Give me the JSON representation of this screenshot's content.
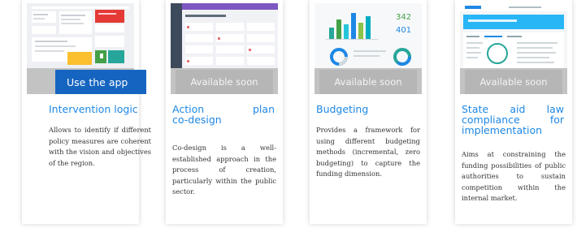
{
  "cards": [
    {
      "title_lines": [
        "Intervention logic"
      ],
      "button_label": "Use the app",
      "description": "Allows to identify if different policy measures are coherent with the vision and objectives of the region."
    },
    {
      "title_lines": [
        "Action plan",
        "co-design"
      ],
      "button_label": "Available soon",
      "description": "Co-design is a well-established approach in the process of creation, particularly within the public sector."
    },
    {
      "title_lines": [
        "Budgeting"
      ],
      "button_label": "Available soon",
      "description": "Provides a framework for using different budgeting methods (incremental, zero budgeting) to capture the funding dimension.",
      "thumb_numbers": [
        "342",
        "401"
      ]
    },
    {
      "title_lines": [
        "State aid law",
        "compliance for",
        "implementation"
      ],
      "button_label": "Available soon",
      "description": "Aims at constraining the funding possibilities of public authorities to sustain competition within the internal market."
    }
  ],
  "colors": {
    "accent": "#1565c0",
    "title": "#1e88e5",
    "soon_button": "#b6b6b6",
    "band": "#c3c3c3"
  }
}
